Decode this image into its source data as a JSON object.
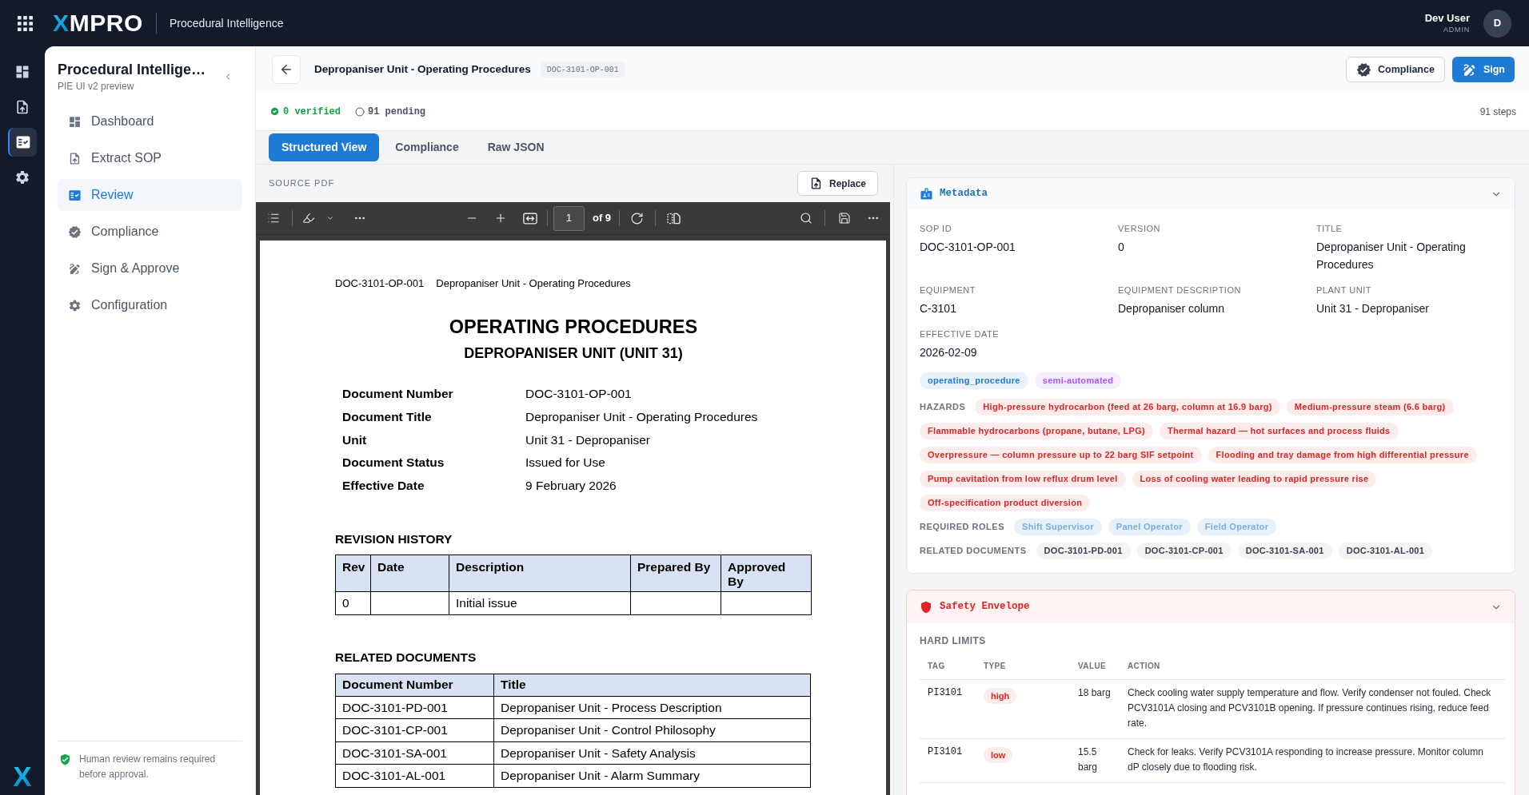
{
  "topbar": {
    "logo": "XMPRO",
    "app_name": "Procedural Intelligence",
    "user_name": "Dev User",
    "user_role": "ADMIN",
    "avatar_initial": "D"
  },
  "rail": {
    "items": [
      {
        "selected": false
      },
      {
        "selected": false
      },
      {
        "selected": true
      },
      {
        "selected": false
      }
    ],
    "logo_mark": "X"
  },
  "sidebar": {
    "title": "Procedural Intellige…",
    "subtitle": "PIE UI v2 preview",
    "items": [
      {
        "label": "Dashboard",
        "selected": false
      },
      {
        "label": "Extract SOP",
        "selected": false
      },
      {
        "label": "Review",
        "selected": true
      },
      {
        "label": "Compliance",
        "selected": false
      },
      {
        "label": "Sign & Approve",
        "selected": false
      },
      {
        "label": "Configuration",
        "selected": false
      }
    ],
    "footer_note": "Human review remains required before approval."
  },
  "header": {
    "title": "Depropaniser Unit - Operating Procedures",
    "doc_id": "DOC-3101-OP-001",
    "buttons": [
      {
        "label": "Compliance",
        "kind": "secondary"
      },
      {
        "label": "Sign",
        "kind": "primary"
      }
    ]
  },
  "status": {
    "verified": "0 verified",
    "pending": "91 pending",
    "steps": "91 steps"
  },
  "tabs": [
    {
      "label": "Structured View",
      "selected": true
    },
    {
      "label": "Compliance",
      "selected": false
    },
    {
      "label": "Raw JSON",
      "selected": false
    }
  ],
  "source_pdf": {
    "label": "SOURCE PDF",
    "replace_button": "Replace",
    "toolbar": {
      "page": "1",
      "page_count": "of 9"
    },
    "page": {
      "running_header": [
        "DOC-3101-OP-001",
        "Depropaniser Unit - Operating Procedures"
      ],
      "title": "OPERATING PROCEDURES",
      "subtitle": "DEPROPANISER UNIT (UNIT 31)",
      "fields": [
        {
          "label": "Document Number",
          "value": "DOC-3101-OP-001"
        },
        {
          "label": "Document Title",
          "value": "Depropaniser Unit - Operating Procedures"
        },
        {
          "label": "Unit",
          "value": "Unit 31 - Depropaniser"
        },
        {
          "label": "Document Status",
          "value": "Issued for Use"
        },
        {
          "label": "Effective Date",
          "value": "9 February 2026"
        }
      ],
      "revision_history": {
        "heading": "REVISION HISTORY",
        "columns": [
          "Rev",
          "Date",
          "Description",
          "Prepared By",
          "Approved By"
        ],
        "rows": [
          {
            "rev": "0",
            "description": "Initial issue"
          }
        ]
      },
      "related_documents": {
        "heading": "RELATED DOCUMENTS",
        "columns": [
          "Document Number",
          "Title"
        ],
        "rows": [
          [
            "DOC-3101-PD-001",
            "Depropaniser Unit - Process Description"
          ],
          [
            "DOC-3101-CP-001",
            "Depropaniser Unit - Control Philosophy"
          ],
          [
            "DOC-3101-SA-001",
            "Depropaniser Unit - Safety Analysis"
          ],
          [
            "DOC-3101-AL-001",
            "Depropaniser Unit - Alarm Summary"
          ]
        ]
      }
    }
  },
  "metadata": {
    "title": "Metadata",
    "fields": [
      {
        "label": "SOP ID",
        "value": "DOC-3101-OP-001"
      },
      {
        "label": "VERSION",
        "value": "0"
      },
      {
        "label": "TITLE",
        "value": "Depropaniser Unit - Operating Procedures"
      },
      {
        "label": "EQUIPMENT",
        "value": "C-3101"
      },
      {
        "label": "EQUIPMENT DESCRIPTION",
        "value": "Depropaniser column"
      },
      {
        "label": "PLANT UNIT",
        "value": "Unit 31 - Depropaniser"
      },
      {
        "label": "EFFECTIVE DATE",
        "value": "2026-02-09"
      }
    ],
    "tags": [
      {
        "label": "operating_procedure",
        "color": "#1e7bd4"
      },
      {
        "label": "semi-automated",
        "color": "#a855f7"
      }
    ],
    "hazards": {
      "label": "HAZARDS",
      "items": [
        "High-pressure hydrocarbon (feed at 26 barg, column at 16.9 barg)",
        "Medium-pressure steam (6.6 barg)",
        "Flammable hydrocarbons (propane, butane, LPG)",
        "Thermal hazard — hot surfaces and process fluids",
        "Overpressure — column pressure up to 22 barg SIF setpoint",
        "Flooding and tray damage from high differential pressure",
        "Pump cavitation from low reflux drum level",
        "Loss of cooling water leading to rapid pressure rise",
        "Off-specification product diversion"
      ]
    },
    "required_roles": {
      "label": "REQUIRED ROLES",
      "items": [
        "Shift Supervisor",
        "Panel Operator",
        "Field Operator"
      ]
    },
    "related_documents": {
      "label": "RELATED DOCUMENTS",
      "items": [
        "DOC-3101-PD-001",
        "DOC-3101-CP-001",
        "DOC-3101-SA-001",
        "DOC-3101-AL-001"
      ]
    }
  },
  "safety_envelope": {
    "title": "Safety Envelope",
    "section": "HARD LIMITS",
    "columns": [
      "TAG",
      "TYPE",
      "VALUE",
      "ACTION"
    ],
    "rows": [
      {
        "tag": "PI3101",
        "type": "high",
        "value": "18 barg",
        "action": "Check cooling water supply temperature and flow. Verify condenser not fouled. Check PCV3101A closing and PCV3101B opening. If pressure continues rising, reduce feed rate."
      },
      {
        "tag": "PI3101",
        "type": "low",
        "value": "15.5 barg",
        "action": "Check for leaks. Verify PCV3101A responding to increase pressure. Monitor column dP closely due to flooding risk."
      }
    ]
  }
}
